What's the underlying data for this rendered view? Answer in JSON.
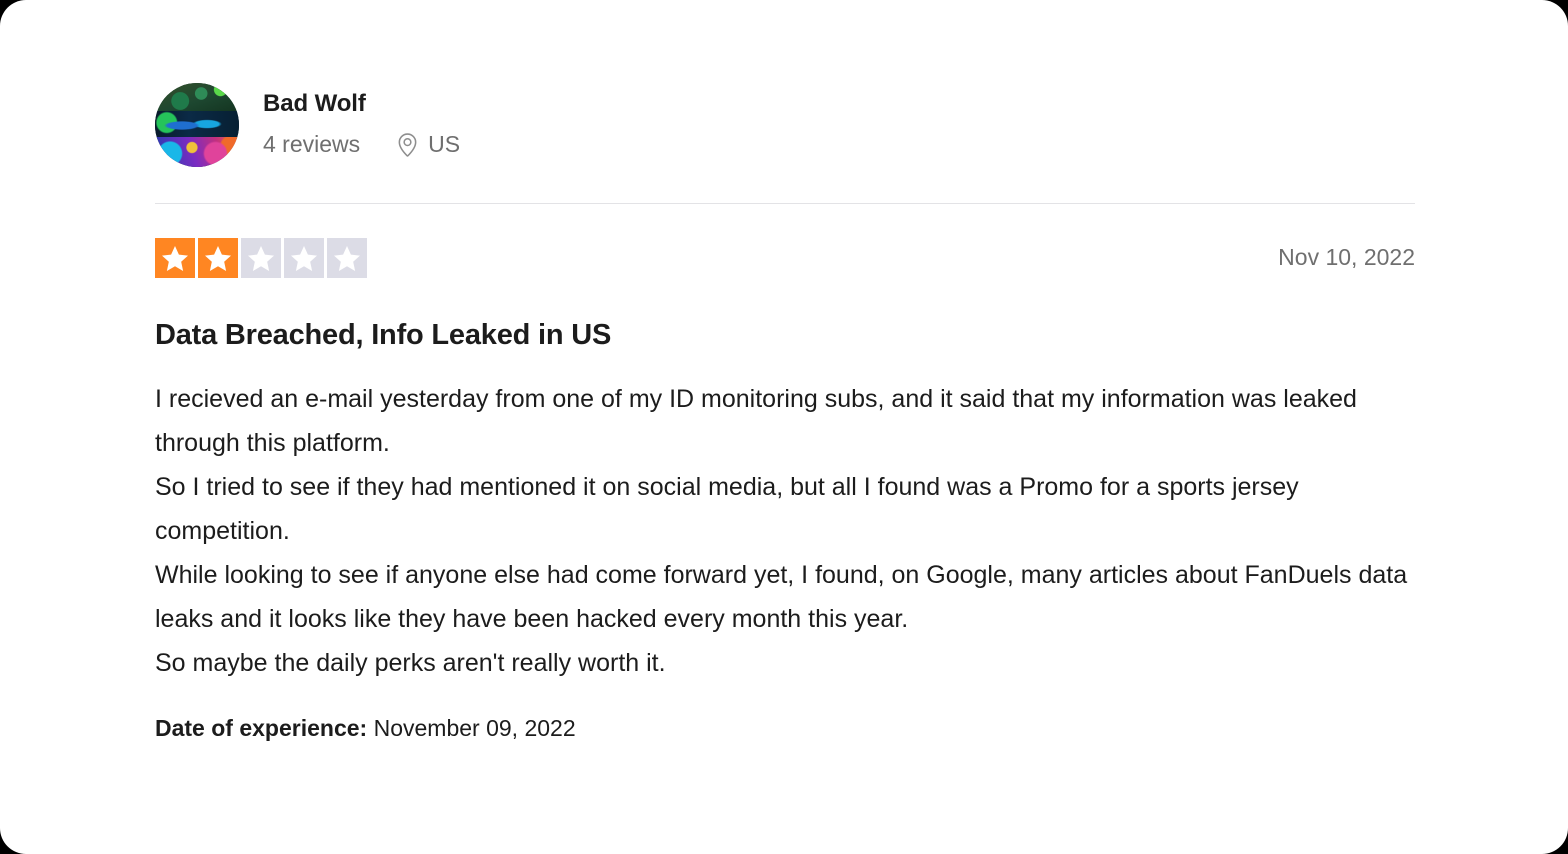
{
  "consumer": {
    "name": "Bad Wolf",
    "reviews_count": "4 reviews",
    "location": "US",
    "location_icon": "location-pin-icon",
    "avatar_alt": "Bad Wolf avatar"
  },
  "rating": {
    "value": 2,
    "max": 5,
    "filled_color": "#ff8622",
    "empty_color": "#dcdce6",
    "star_icon": "star-icon"
  },
  "review": {
    "date": "Nov 10, 2022",
    "title": "Data Breached, Info Leaked in US",
    "paragraphs": [
      "I recieved an e-mail yesterday from one of my ID monitoring subs, and it said that my information was leaked through this platform.",
      "So I tried to see if they had mentioned it on social media, but all I found was a Promo for a sports jersey competition.",
      "While looking to see if anyone else had come forward yet, I found, on Google, many articles about FanDuels data leaks and it looks like they have been hacked every month this year.",
      "So maybe the daily perks aren't really worth it."
    ],
    "date_of_experience_label": "Date of experience:",
    "date_of_experience_value": "November 09, 2022"
  }
}
